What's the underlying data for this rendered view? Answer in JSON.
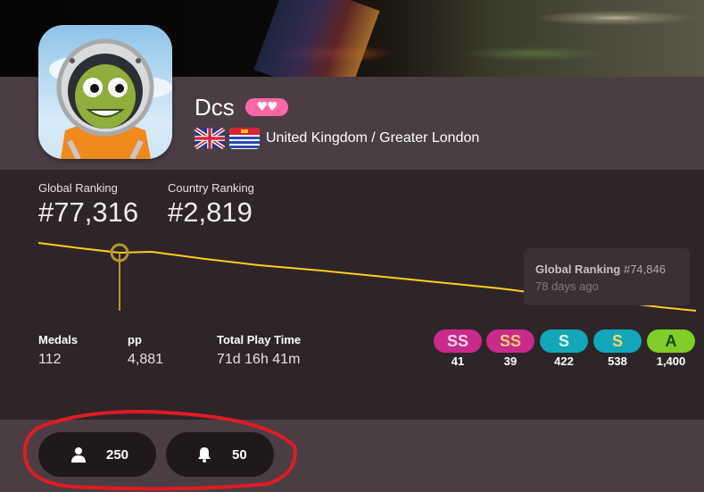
{
  "profile": {
    "username": "Dcs",
    "supporter_badge": "♥♥",
    "country_flag": "uk-flag-icon",
    "region_flag": "london-flag-icon",
    "location": "United Kingdom / Greater London"
  },
  "ranking": {
    "global_label": "Global Ranking",
    "global_value": "#77,316",
    "country_label": "Country Ranking",
    "country_value": "#2,819",
    "tooltip_label": "Global Ranking",
    "tooltip_value": "#74,846",
    "tooltip_time": "78 days ago",
    "line_color": "#ffcc22"
  },
  "stats": {
    "medals_label": "Medals",
    "medals_value": "112",
    "pp_label": "pp",
    "pp_value": "4,881",
    "playtime_label": "Total Play Time",
    "playtime_value": "71d 16h 41m"
  },
  "grades": [
    {
      "label": "SS",
      "count": "41",
      "bg": "#c92a8c",
      "fg": "#ffd7ef"
    },
    {
      "label": "SS",
      "count": "39",
      "bg": "#c92a8c",
      "fg": "#ffd56b"
    },
    {
      "label": "S",
      "count": "422",
      "bg": "#12a7b8",
      "fg": "#e6ffff"
    },
    {
      "label": "S",
      "count": "538",
      "bg": "#12a7b8",
      "fg": "#ffd56b"
    },
    {
      "label": "A",
      "count": "1,400",
      "bg": "#7fce2a",
      "fg": "#0f4d10"
    }
  ],
  "footer": {
    "followers_icon": "user-icon",
    "followers_count": "250",
    "mapping_icon": "bell-icon",
    "mapping_count": "50"
  },
  "annotation": {
    "color": "#e01b24"
  }
}
